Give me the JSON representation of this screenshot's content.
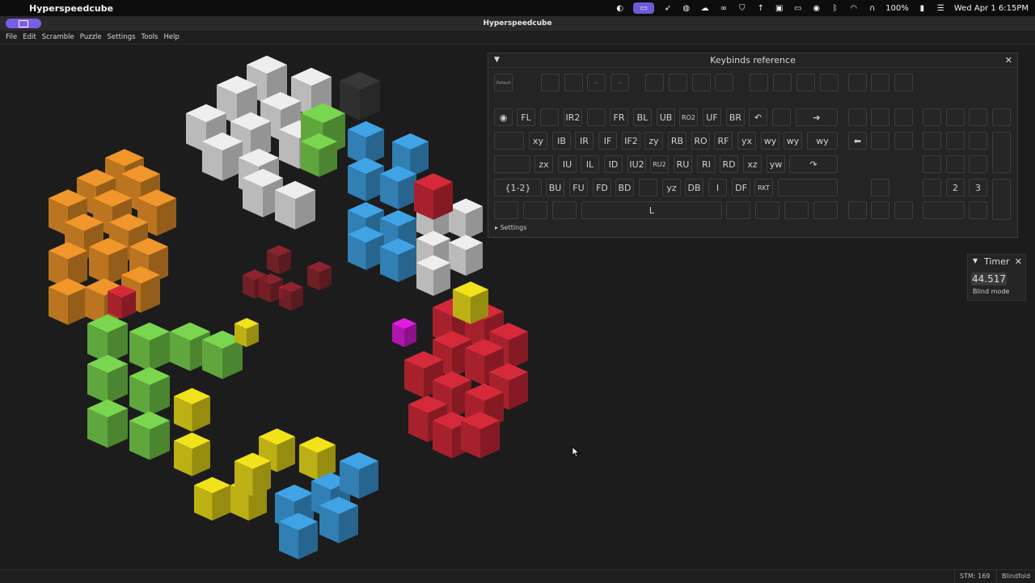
{
  "os_menubar": {
    "app_name": "Hyperspeedcube",
    "battery": "100%",
    "clock": "Wed Apr 1  6:15PM"
  },
  "window": {
    "title": "Hyperspeedcube"
  },
  "app_menu": [
    "File",
    "Edit",
    "Scramble",
    "Puzzle",
    "Settings",
    "Tools",
    "Help"
  ],
  "keybinds": {
    "title": "Keybinds reference",
    "settings_label": "Settings",
    "keys": {
      "default": "Default",
      "r1": [
        "FL",
        "IR2",
        "FR",
        "BL",
        "UB",
        "RO2",
        "UF",
        "BR"
      ],
      "r2": [
        "xy",
        "IB",
        "IR",
        "IF",
        "IF2",
        "zy",
        "RB",
        "RO",
        "RF",
        "yx",
        "wy",
        "wy",
        "wy"
      ],
      "r3": [
        "zx",
        "IU",
        "IL",
        "ID",
        "IU2",
        "RU2",
        "RU",
        "RI",
        "RD",
        "xz",
        "yw"
      ],
      "r4": [
        "{1-2}",
        "BU",
        "FU",
        "FD",
        "BD",
        "yz",
        "DB",
        "I",
        "DF",
        "RKT"
      ],
      "space": "L",
      "num2": "2",
      "num3": "3"
    }
  },
  "timer": {
    "title": "Timer",
    "value": "44.517",
    "mode": "Blind mode"
  },
  "status": {
    "stm": "STM: 169",
    "mode": "Blindfold"
  },
  "colors": {
    "white": "#eeeeee",
    "orange": "#f0962a",
    "green": "#7ad64e",
    "blue": "#3fa3e6",
    "red": "#d62a3a",
    "yellow": "#f2e21a",
    "magenta": "#e21ce0",
    "accent": "#7a5ee8"
  }
}
